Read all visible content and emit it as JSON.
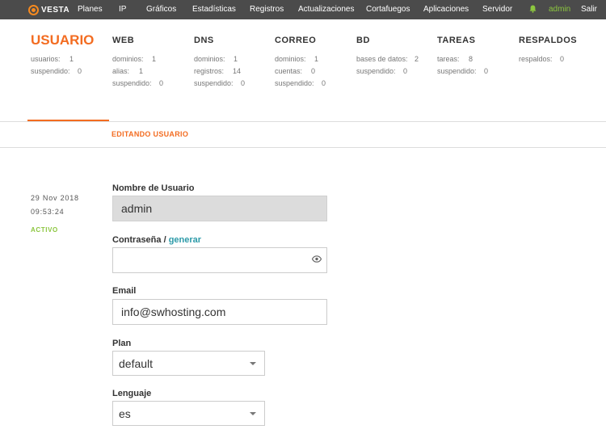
{
  "topnav": {
    "logo": "VESTA",
    "items": [
      "Planes",
      "IP",
      "Gráficos",
      "Estadísticas",
      "Registros",
      "Actualizaciones",
      "Cortafuegos",
      "Aplicaciones",
      "Servidor"
    ],
    "user": "admin",
    "logout": "Salir"
  },
  "stats": {
    "usuario": {
      "title": "USUARIO",
      "rows": [
        [
          "usuarios:",
          "1"
        ],
        [
          "suspendido:",
          "0"
        ]
      ]
    },
    "web": {
      "title": "WEB",
      "rows": [
        [
          "dominios:",
          "1"
        ],
        [
          "alias:",
          "1"
        ],
        [
          "suspendido:",
          "0"
        ]
      ]
    },
    "dns": {
      "title": "DNS",
      "rows": [
        [
          "dominios:",
          "1"
        ],
        [
          "registros:",
          "14"
        ],
        [
          "suspendido:",
          "0"
        ]
      ]
    },
    "correo": {
      "title": "CORREO",
      "rows": [
        [
          "dominios:",
          "1"
        ],
        [
          "cuentas:",
          "0"
        ],
        [
          "suspendido:",
          "0"
        ]
      ]
    },
    "bd": {
      "title": "BD",
      "rows": [
        [
          "bases de datos:",
          "2"
        ],
        [
          "suspendido:",
          "0"
        ]
      ]
    },
    "tareas": {
      "title": "TAREAS",
      "rows": [
        [
          "tareas:",
          "8"
        ],
        [
          "suspendido:",
          "0"
        ]
      ]
    },
    "respaldos": {
      "title": "RESPALDOS",
      "rows": [
        [
          "respaldos:",
          "0"
        ]
      ]
    }
  },
  "section": {
    "title": "EDITANDO USUARIO"
  },
  "info": {
    "date": "29 Nov 2018",
    "time": "09:53:24",
    "status": "ACTIVO"
  },
  "form": {
    "username_label": "Nombre de Usuario",
    "username_value": "admin",
    "password_label": "Contraseña /",
    "password_generate": "generar",
    "password_value": "",
    "email_label": "Email",
    "email_value": "info@swhosting.com",
    "plan_label": "Plan",
    "plan_value": "default",
    "language_label": "Lenguaje",
    "language_value": "es"
  },
  "colors": {
    "accent": "#f36c21",
    "active": "#8cc63f",
    "link": "#2c9aa8",
    "nav_bg": "#4b4b4b"
  }
}
